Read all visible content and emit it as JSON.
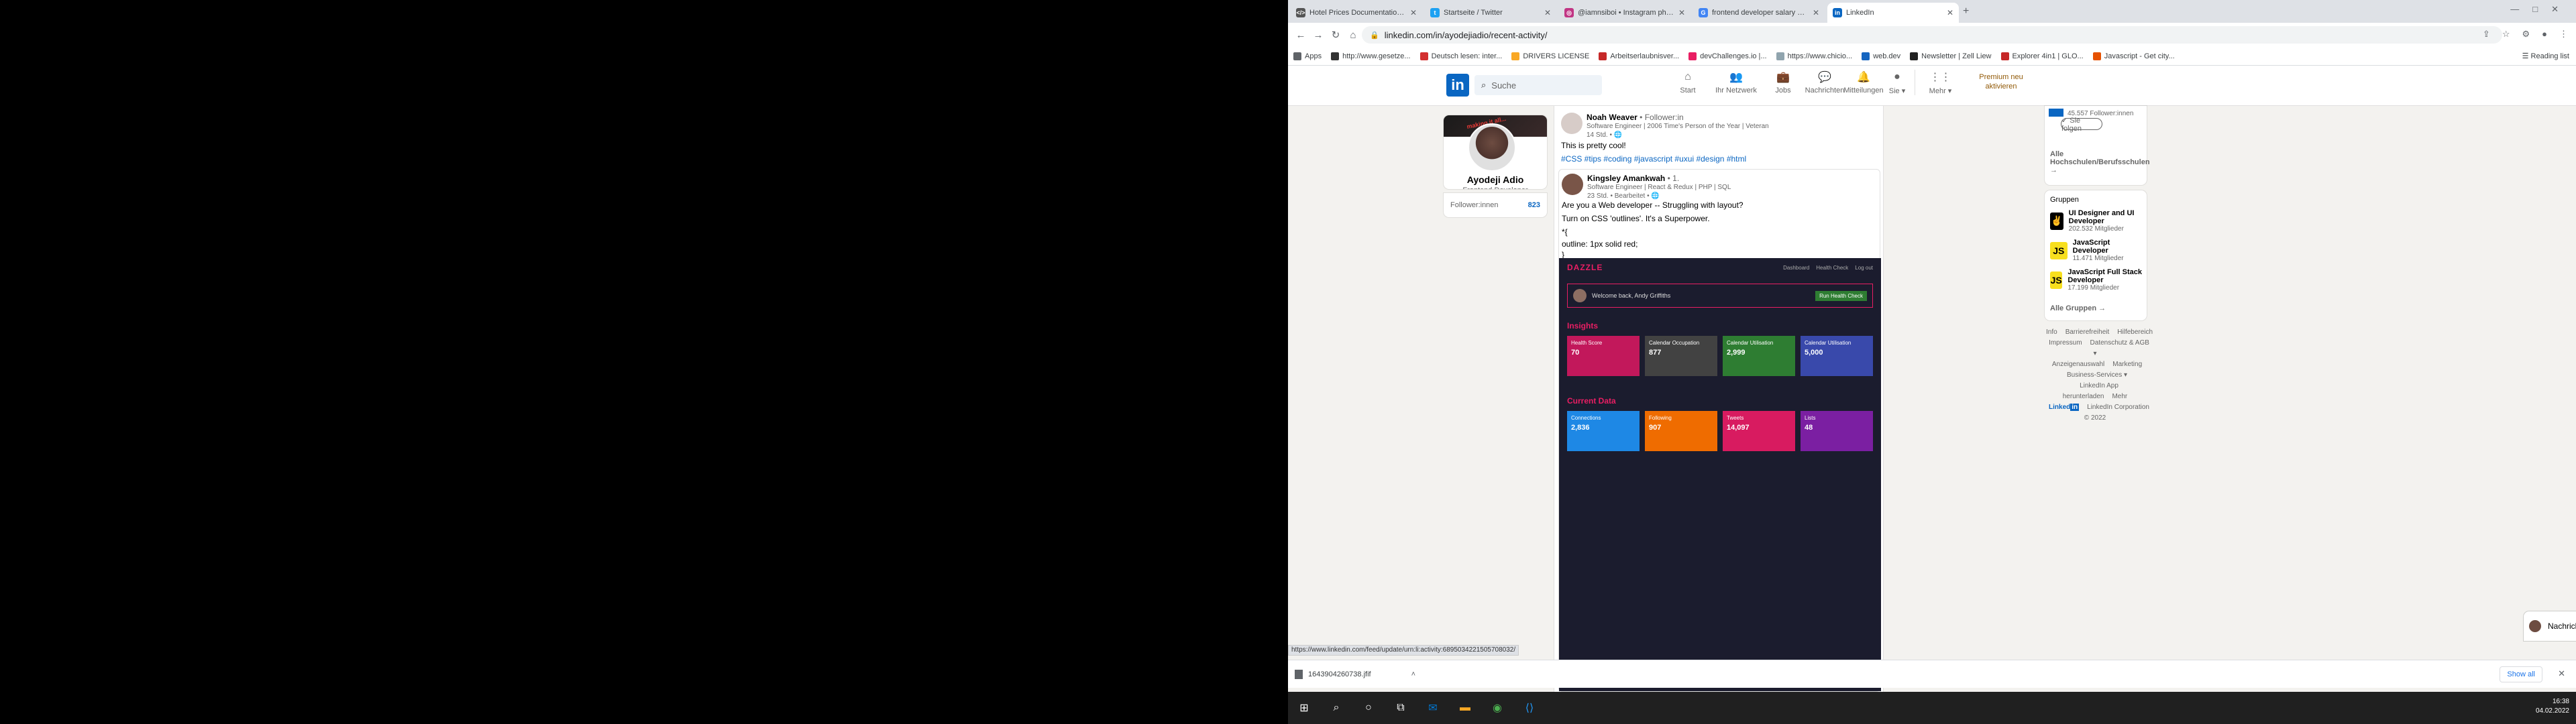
{
  "browser": {
    "tabs": [
      {
        "title": "Hotel Prices Documentation Ov...",
        "color": "#555555",
        "glyph": "</>"
      },
      {
        "title": "Startseite / Twitter",
        "color": "#1da1f2",
        "glyph": "t"
      },
      {
        "title": "@iamnsiboi • Instagram photo...",
        "color": "#c13584",
        "glyph": "◎"
      },
      {
        "title": "frontend developer salary glassc...",
        "color": "#4285f4",
        "glyph": "G"
      },
      {
        "title": "LinkedIn",
        "color": "#0a66c2",
        "glyph": "in"
      }
    ],
    "url": "linkedin.com/in/ayodejiadio/recent-activity/",
    "bookmarks": [
      {
        "label": "Apps",
        "color": "#5f6368"
      },
      {
        "label": "http://www.gesetze...",
        "color": "#333333"
      },
      {
        "label": "Deutsch lesen: inter...",
        "color": "#d32f2f"
      },
      {
        "label": "DRIVERS LICENSE",
        "color": "#f9a825"
      },
      {
        "label": "Arbeitserlaubnisver...",
        "color": "#c62828"
      },
      {
        "label": "devChallenges.io |...",
        "color": "#e91e63"
      },
      {
        "label": "https://www.chicio...",
        "color": "#90a4ae"
      },
      {
        "label": "web.dev",
        "color": "#1565c0"
      },
      {
        "label": "Newsletter | Zell Liew",
        "color": "#212121"
      },
      {
        "label": "Explorer 4in1 | GLO...",
        "color": "#c62828"
      },
      {
        "label": "Javascript - Get city...",
        "color": "#e65100"
      }
    ],
    "reading_list": "Reading list",
    "status_url": "https://www.linkedin.com/feed/update/urn:li:activity:6895034221505708032/"
  },
  "linkedin": {
    "search_placeholder": "Suche",
    "nav": [
      {
        "label": "Start",
        "icon": "home-icon",
        "glyph": "⌂"
      },
      {
        "label": "Ihr Netzwerk",
        "icon": "network-icon",
        "glyph": "👥"
      },
      {
        "label": "Jobs",
        "icon": "jobs-icon",
        "glyph": "💼"
      },
      {
        "label": "Nachrichten",
        "icon": "messaging-icon",
        "glyph": "💬"
      },
      {
        "label": "Mitteilungen",
        "icon": "bell-icon",
        "glyph": "🔔"
      },
      {
        "label": "Sie ▾",
        "icon": "me-avatar-icon",
        "glyph": "●"
      },
      {
        "label": "Mehr ▾",
        "icon": "grid-icon",
        "glyph": "⋮⋮"
      }
    ],
    "premium": "Premium neu aktivieren",
    "profile": {
      "name": "Ayodeji Adio",
      "role": "Frontend Developer",
      "followers_label": "Follower:innen",
      "followers_count": "823",
      "banner_text": "making it all..."
    },
    "feed": {
      "post1": {
        "name": "Noah Weaver",
        "relation": "• Follower:in",
        "headline": "Software Engineer | 2006 Time's Person of the Year | Veteran",
        "time": "14 Std. • 🌐",
        "text": "This is pretty cool!",
        "tags": "#CSS #tips #coding #javascript #uxui #design #html"
      },
      "post2": {
        "name": "Kingsley Amankwah",
        "relation": "• 1.",
        "headline": "Software Engineer | React & Redux | PHP | SQL",
        "time": "23 Std. • Bearbeitet • 🌐",
        "lines": [
          "Are you a Web developer -- Struggling with layout?",
          "Turn on CSS 'outlines'. It's a Superpower.",
          "*{",
          "outline: 1px solid red;",
          "}"
        ]
      },
      "dashboard": {
        "brand": "DAZZLE",
        "links": [
          "Dashboard",
          "Health Check",
          "Log out"
        ],
        "welcome": "Welcome back, Andy Griffiths",
        "btn": "Run Health Check",
        "insights": "Insights",
        "insight_cards": [
          {
            "label": "Health Score",
            "value": "70",
            "color": "#c2185b"
          },
          {
            "label": "Calendar Occupation",
            "value": "877",
            "color": "#424242"
          },
          {
            "label": "Calendar Utilisation",
            "value": "2,999",
            "color": "#2e7d32"
          },
          {
            "label": "Calendar Utilisation",
            "value": "5,000",
            "color": "#3949ab"
          }
        ],
        "current": "Current Data",
        "current_cards": [
          {
            "label": "Connections",
            "value": "2,836",
            "color": "#1e88e5"
          },
          {
            "label": "Following",
            "value": "907",
            "color": "#ef6c00"
          },
          {
            "label": "Tweets",
            "value": "14,097",
            "color": "#d81b60"
          },
          {
            "label": "Lists",
            "value": "48",
            "color": "#7b1fa2"
          }
        ]
      }
    },
    "right": {
      "followers_text": "45.557 Follower:innen",
      "follow_btn": "✓ Sie folgen",
      "all_schools": "Alle Hochschulen/Berufsschulen →",
      "groups_title": "Gruppen",
      "groups": [
        {
          "name": "UI Designer and UI Developer",
          "members": "202.532 Mitglieder",
          "bg": "#000000",
          "fg": "#ffeb3b",
          "glyph": "✌"
        },
        {
          "name": "JavaScript Developer",
          "members": "11.471 Mitglieder",
          "bg": "#f7df1e",
          "fg": "#000000",
          "glyph": "JS"
        },
        {
          "name": "JavaScript Full Stack Developer",
          "members": "17.199 Mitglieder",
          "bg": "#f7df1e",
          "fg": "#000000",
          "glyph": "JS"
        }
      ],
      "all_groups": "Alle Gruppen →"
    },
    "footer": {
      "links": [
        "Info",
        "Barrierefreiheit",
        "Hilfebereich",
        "Impressum",
        "Datenschutz & AGB ▾",
        "Anzeigenauswahl",
        "Marketing",
        "Business-Services ▾",
        "LinkedIn App herunterladen",
        "Mehr"
      ],
      "copyright": "LinkedIn Corporation © 2022"
    },
    "messages_label": "Nachrichten"
  },
  "download": {
    "file": "1643904260738.jfif",
    "show_all": "Show all"
  },
  "taskbar": {
    "time": "16:38",
    "date": "04.02.2022"
  }
}
